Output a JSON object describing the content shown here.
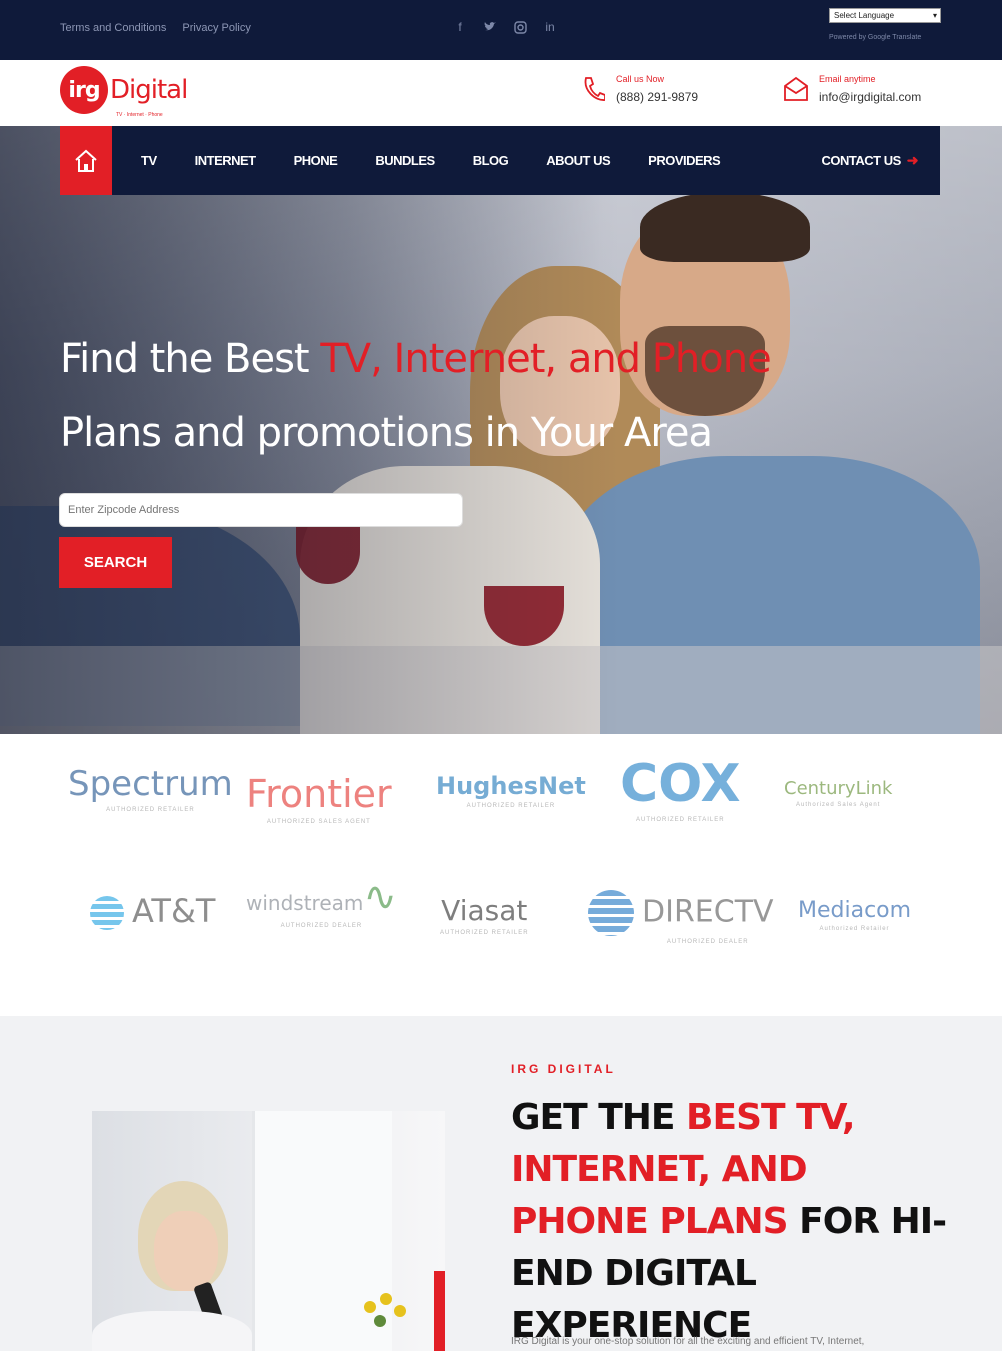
{
  "topbar": {
    "links": [
      "Terms and Conditions",
      "Privacy Policy"
    ],
    "socials": [
      "facebook-icon",
      "twitter-icon",
      "instagram-icon",
      "linkedin-icon"
    ],
    "language_select": "Select Language",
    "powered_by": "Powered by Google Translate"
  },
  "header": {
    "logo_mark": "irg",
    "logo_text": "Digital",
    "logo_tagline": "TV · Internet · Phone",
    "call_label": "Call us Now",
    "call_value": "(888) 291-9879",
    "email_label": "Email anytime",
    "email_value": "info@irgdigital.com"
  },
  "nav": {
    "items": [
      "TV",
      "INTERNET",
      "PHONE",
      "BUNDLES",
      "BLOG",
      "ABOUT US",
      "PROVIDERS"
    ],
    "contact": "CONTACT US"
  },
  "hero": {
    "title_white_1": "Find the Best ",
    "title_red": "TV, Internet, and Phone",
    "title_white_2": "Plans and promotions in Your Area",
    "input_placeholder": "Enter Zipcode Address",
    "search_label": "SEARCH"
  },
  "providers": [
    {
      "name": "Spectrum",
      "sub": "AUTHORIZED RETAILER",
      "color": "#1c4f8c"
    },
    {
      "name": "Frontier",
      "sub": "AUTHORIZED SALES AGENT",
      "color": "#e2302b"
    },
    {
      "name": "HughesNet",
      "sub": "AUTHORIZED RETAILER",
      "color": "#1c76b8"
    },
    {
      "name": "COX",
      "sub": "AUTHORIZED RETAILER",
      "color": "#1c7cc4"
    },
    {
      "name": "CenturyLink",
      "sub": "Authorized Sales Agent",
      "color": "#5b8a2a"
    },
    {
      "name": "AT&T",
      "sub": "",
      "color": "#0a7fc4"
    },
    {
      "name": "windstream",
      "sub": "AUTHORIZED DEALER",
      "color": "#3f8f3c"
    },
    {
      "name": "Viasat",
      "sub": "AUTHORIZED RETAILER",
      "color": "#2a2a2a"
    },
    {
      "name": "DIRECTV",
      "sub": "AUTHORIZED DEALER",
      "color": "#1a73c2"
    },
    {
      "name": "Mediacom",
      "sub": "Authorized Retailer",
      "color": "#1f5aa6"
    }
  ],
  "about": {
    "eyebrow": "IRG DIGITAL",
    "title_1": "GET THE ",
    "title_red_1": "BEST TV, INTERNET, AND PHONE PLANS",
    "title_2": " FOR HI-END DIGITAL EXPERIENCE",
    "description": "IRG Digital is your one-stop solution for all the exciting and efficient TV, Internet,"
  },
  "colors": {
    "brand_red": "#e21f26",
    "navy": "#0f1a3a"
  }
}
